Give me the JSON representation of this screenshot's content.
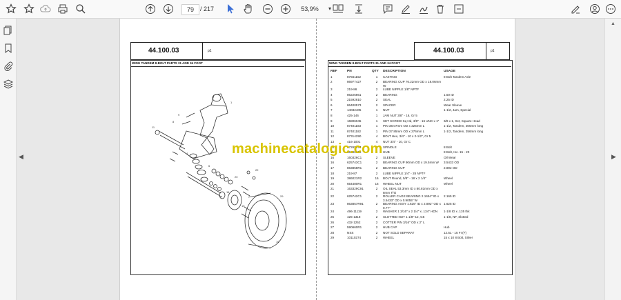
{
  "toolbar": {
    "current_page": "79",
    "total_pages": "/ 217",
    "zoom": "53,9%"
  },
  "document": {
    "left_page": {
      "code": "44.100.03",
      "page_tag": "p1",
      "subtitle": "WING TANDEM 8-BOLT PARTS 31 AND 34 FOOT"
    },
    "right_page": {
      "code": "44.100.03",
      "page_tag": "p1",
      "subtitle": "WING TANDEM 8-BOLT PARTS 31 AND 34 FOOT",
      "columns": [
        "REF",
        "PN",
        "QTY",
        "DESCRIPTION",
        "USAGE"
      ],
      "rows": [
        [
          "1",
          "87561152",
          "1",
          "CASTING",
          "8 Bolt Tandem Axle"
        ],
        [
          "2",
          "86977427",
          "2",
          "BEARING CUP 76.22mm OD x 18.06mm W",
          ""
        ],
        [
          "3",
          "219-86",
          "2",
          "LUBE NIPPLE 1/8\" NPTF",
          ""
        ],
        [
          "4",
          "86225861",
          "2",
          "BEARING",
          "1.50 ID"
        ],
        [
          "5",
          "21592810",
          "2",
          "SEAL",
          "2.25 ID"
        ],
        [
          "6",
          "86400573",
          "2",
          "SPACER",
          "Wear Sleeve"
        ],
        [
          "7",
          "14032405",
          "1",
          "NUT",
          "1-1/2, Jam, Special"
        ],
        [
          "8",
          "425-146",
          "1",
          "JAM NUT 3/8\" - 16, Gr 5",
          ""
        ],
        [
          "9",
          "16806045",
          "1",
          "SET SCREW Sq Hd, 3/8\" - 16 UNC x 1\"",
          "3/8 x 1, Set, Square Head"
        ],
        [
          "10",
          "87401183",
          "1",
          "PIN 38.07mm OD x 325mm L",
          "1-1/2, Tandem, 305mm long"
        ],
        [
          "11",
          "87401182",
          "1",
          "PIN 37.85mm OD x 276mm L",
          "1-1/2, Tandem, 356mm long"
        ],
        [
          "12",
          "87314290",
          "4",
          "BOLT Hex, 3/4\" - 10 x 2-1/2\", Gr 5",
          ""
        ],
        [
          "13",
          "416-1001",
          "4",
          "NUT 3/4\" - 10, Gr C",
          ""
        ],
        [
          "14",
          "87269973",
          "2",
          "SPINDLE",
          "8 Bolt"
        ],
        [
          "15",
          "86590868",
          "2",
          "HUB",
          "8 Bolt, Inc. 15 - 20"
        ],
        [
          "16",
          "160326C1",
          "2",
          "SLEEVE",
          "Oil Wear"
        ],
        [
          "16",
          "625743C1",
          "2",
          "BEARING CUP 90mm OD x 19.5mm W",
          "3.5433 OD"
        ],
        [
          "17",
          "863858R1",
          "2",
          "BEARING CUP",
          "2.892 OD"
        ],
        [
          "18",
          "219-87",
          "2",
          "LUBE NIPPLE 1/4\" - 28 NPTF",
          ""
        ],
        [
          "19",
          "386021R2",
          "16",
          "BOLT Round, 5/8\" - 18 x 2 1/4\"",
          "Wheel"
        ],
        [
          "20",
          "654480R1",
          "16",
          "WHEEL NUT",
          "Wheel"
        ],
        [
          "21",
          "163329C91",
          "2",
          "OIL SEAL 53.3mm ID x 80.81mm OD x 8mm Thk",
          ""
        ],
        [
          "22",
          "625742C1",
          "2",
          "ROLLER CAGE BEARING 2.1654\" ID x 3.5433\" OD x 0.9055\" W",
          "2.165 ID"
        ],
        [
          "23",
          "863857R91",
          "2",
          "BEARING ASSY 1.625\" ID x 2.892\" OD x 0.77\"",
          "1.625 ID"
        ],
        [
          "24",
          "496-11119",
          "2",
          "WASHER 1 3/16\" x 2 1/4\" x .134\" HDN",
          "1-1/8 ID x .135 thk"
        ],
        [
          "25",
          "425-1318",
          "2",
          "SLOTTED NUT 1 1/8\"-12, G5",
          "1-1/8, NF, Slotted"
        ],
        [
          "26",
          "432-1252",
          "2",
          "COTTER PIN 3/16\" OD x 2\" L",
          ""
        ],
        [
          "27",
          "590660R1",
          "2",
          "HUB CAP",
          "Hub"
        ],
        [
          "28",
          "NSS",
          "2",
          "NOT SOLD SEPARAT",
          "12.5L - 15 FI (F)"
        ],
        [
          "29",
          "10110274",
          "2",
          "WHEEL",
          "15 x 10 8 Bolt, Silver"
        ]
      ]
    }
  },
  "watermark": "machinecatalogic.com",
  "icons": {
    "accent_color": "#3c6fd6",
    "watermark_color": "#d8c400"
  }
}
